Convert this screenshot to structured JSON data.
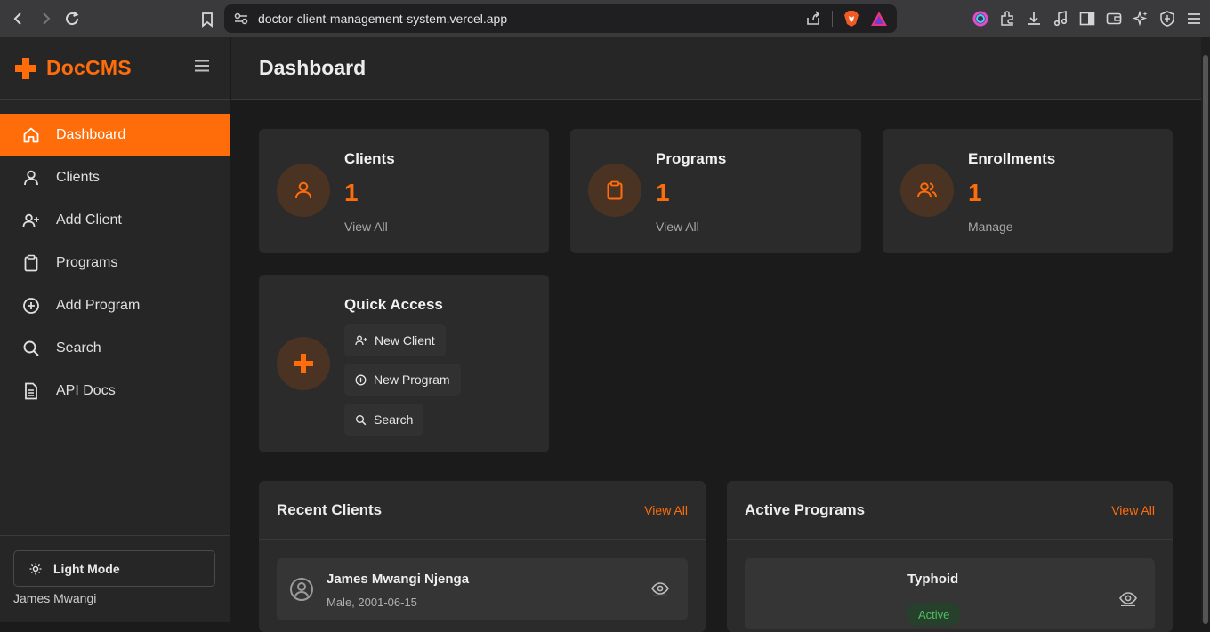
{
  "browser": {
    "url": "doctor-client-management-system.vercel.app"
  },
  "sidebar": {
    "brand": "DocCMS",
    "items": [
      {
        "label": "Dashboard",
        "icon": "home-icon",
        "active": true
      },
      {
        "label": "Clients",
        "icon": "user-icon"
      },
      {
        "label": "Add Client",
        "icon": "user-plus-icon"
      },
      {
        "label": "Programs",
        "icon": "clipboard-icon"
      },
      {
        "label": "Add Program",
        "icon": "plus-circle-icon"
      },
      {
        "label": "Search",
        "icon": "search-icon"
      },
      {
        "label": "API Docs",
        "icon": "document-icon"
      }
    ],
    "theme_toggle": "Light Mode",
    "user": "James Mwangi"
  },
  "header": {
    "title": "Dashboard"
  },
  "stats": [
    {
      "title": "Clients",
      "value": "1",
      "link": "View All",
      "icon": "user-icon"
    },
    {
      "title": "Programs",
      "value": "1",
      "link": "View All",
      "icon": "clipboard-icon"
    },
    {
      "title": "Enrollments",
      "value": "1",
      "link": "Manage",
      "icon": "users-icon"
    }
  ],
  "quick_access": {
    "title": "Quick Access",
    "icon": "plus-icon",
    "buttons": [
      {
        "label": "New Client",
        "icon": "user-plus-icon"
      },
      {
        "label": "New Program",
        "icon": "plus-circle-icon"
      },
      {
        "label": "Search",
        "icon": "search-icon"
      }
    ]
  },
  "recent_clients": {
    "title": "Recent Clients",
    "link": "View All",
    "rows": [
      {
        "name": "James Mwangi Njenga",
        "meta": "Male, 2001-06-15"
      }
    ]
  },
  "active_programs": {
    "title": "Active Programs",
    "link": "View All",
    "rows": [
      {
        "name": "Typhoid",
        "status": "Active"
      }
    ]
  },
  "colors": {
    "accent": "#ff6d0a",
    "active_badge": "#4fbf63"
  }
}
